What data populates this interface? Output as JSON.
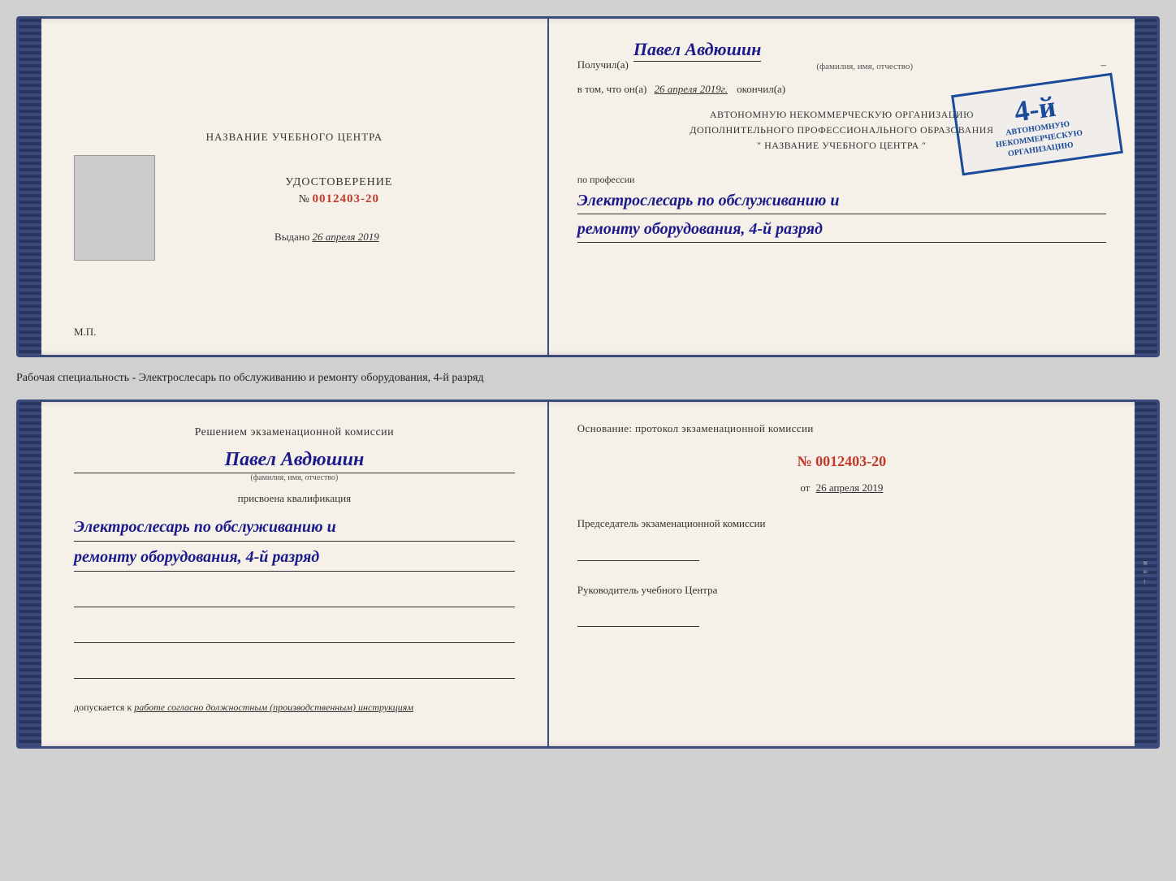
{
  "top_doc": {
    "left": {
      "title": "НАЗВАНИЕ УЧЕБНОГО ЦЕНТРА",
      "photo_alt": "фото",
      "udostoverenie_title": "УДОСТОВЕРЕНИЕ",
      "number_prefix": "№",
      "number": "0012403-20",
      "vydano_label": "Выдано",
      "vydano_date": "26 апреля 2019",
      "mp_label": "М.П."
    },
    "right": {
      "poluchil_label": "Получил(а)",
      "recipient_name": "Павел Авдюшин",
      "fio_hint": "(фамилия, имя, отчество)",
      "vtom_prefix": "в том, что он(а)",
      "vtom_date": "26 апреля 2019г.",
      "okonchil_label": "окончил(а)",
      "org_line1": "АВТОНОМНУЮ НЕКОММЕРЧЕСКУЮ ОРГАНИЗАЦИЮ",
      "org_line2": "ДОПОЛНИТЕЛЬНОГО ПРОФЕССИОНАЛЬНОГО ОБРАЗОВАНИЯ",
      "org_line3": "\" НАЗВАНИЕ УЧЕБНОГО ЦЕНТРА \"",
      "po_professii_label": "по профессии",
      "profession_line1": "Электрослесарь по обслуживанию и",
      "profession_line2": "ремонту оборудования, 4-й разряд",
      "stamp_grade": "4-й",
      "stamp_line1": "АВТОНОМНУЮ НЕКОММЕРЧЕСКУЮ",
      "stamp_line2": "ОРГАНИЗАЦИЮ"
    }
  },
  "middle": {
    "text": "Рабочая специальность - Электрослесарь по обслуживанию и ремонту оборудования, 4-й разряд"
  },
  "bottom_doc": {
    "left": {
      "commission_title": "Решением экзаменационной комиссии",
      "person_name": "Павел Авдюшин",
      "fio_hint": "(фамилия, имя, отчество)",
      "prisvoena_label": "присвоена квалификация",
      "kvalif_line1": "Электрослесарь по обслуживанию и",
      "kvalif_line2": "ремонту оборудования, 4-й разряд",
      "dopuskaetsya_label": "допускается к",
      "dopuskaetsya_text": "работе согласно должностным (производственным) инструкциям"
    },
    "right": {
      "osnovanie_label": "Основание: протокол экзаменационной комиссии",
      "number_prefix": "№",
      "number": "0012403-20",
      "ot_label": "от",
      "ot_date": "26 апреля 2019",
      "predsedatel_label": "Председатель экзаменационной комиссии",
      "rukovoditel_label": "Руководитель учебного Центра"
    }
  }
}
